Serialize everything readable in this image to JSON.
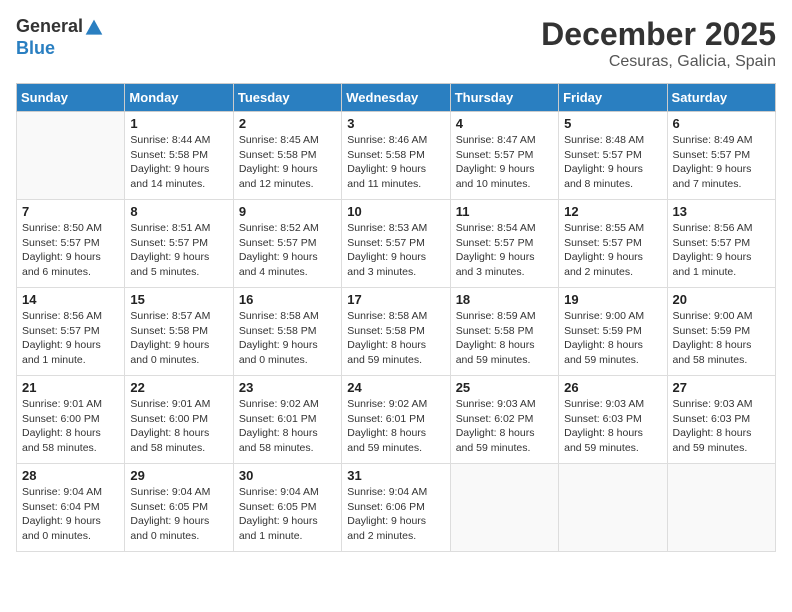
{
  "header": {
    "logo_general": "General",
    "logo_blue": "Blue",
    "month": "December 2025",
    "location": "Cesuras, Galicia, Spain"
  },
  "weekdays": [
    "Sunday",
    "Monday",
    "Tuesday",
    "Wednesday",
    "Thursday",
    "Friday",
    "Saturday"
  ],
  "weeks": [
    [
      {
        "day": "",
        "sunrise": "",
        "sunset": "",
        "daylight": ""
      },
      {
        "day": "1",
        "sunrise": "Sunrise: 8:44 AM",
        "sunset": "Sunset: 5:58 PM",
        "daylight": "Daylight: 9 hours and 14 minutes."
      },
      {
        "day": "2",
        "sunrise": "Sunrise: 8:45 AM",
        "sunset": "Sunset: 5:58 PM",
        "daylight": "Daylight: 9 hours and 12 minutes."
      },
      {
        "day": "3",
        "sunrise": "Sunrise: 8:46 AM",
        "sunset": "Sunset: 5:58 PM",
        "daylight": "Daylight: 9 hours and 11 minutes."
      },
      {
        "day": "4",
        "sunrise": "Sunrise: 8:47 AM",
        "sunset": "Sunset: 5:57 PM",
        "daylight": "Daylight: 9 hours and 10 minutes."
      },
      {
        "day": "5",
        "sunrise": "Sunrise: 8:48 AM",
        "sunset": "Sunset: 5:57 PM",
        "daylight": "Daylight: 9 hours and 8 minutes."
      },
      {
        "day": "6",
        "sunrise": "Sunrise: 8:49 AM",
        "sunset": "Sunset: 5:57 PM",
        "daylight": "Daylight: 9 hours and 7 minutes."
      }
    ],
    [
      {
        "day": "7",
        "sunrise": "Sunrise: 8:50 AM",
        "sunset": "Sunset: 5:57 PM",
        "daylight": "Daylight: 9 hours and 6 minutes."
      },
      {
        "day": "8",
        "sunrise": "Sunrise: 8:51 AM",
        "sunset": "Sunset: 5:57 PM",
        "daylight": "Daylight: 9 hours and 5 minutes."
      },
      {
        "day": "9",
        "sunrise": "Sunrise: 8:52 AM",
        "sunset": "Sunset: 5:57 PM",
        "daylight": "Daylight: 9 hours and 4 minutes."
      },
      {
        "day": "10",
        "sunrise": "Sunrise: 8:53 AM",
        "sunset": "Sunset: 5:57 PM",
        "daylight": "Daylight: 9 hours and 3 minutes."
      },
      {
        "day": "11",
        "sunrise": "Sunrise: 8:54 AM",
        "sunset": "Sunset: 5:57 PM",
        "daylight": "Daylight: 9 hours and 3 minutes."
      },
      {
        "day": "12",
        "sunrise": "Sunrise: 8:55 AM",
        "sunset": "Sunset: 5:57 PM",
        "daylight": "Daylight: 9 hours and 2 minutes."
      },
      {
        "day": "13",
        "sunrise": "Sunrise: 8:56 AM",
        "sunset": "Sunset: 5:57 PM",
        "daylight": "Daylight: 9 hours and 1 minute."
      }
    ],
    [
      {
        "day": "14",
        "sunrise": "Sunrise: 8:56 AM",
        "sunset": "Sunset: 5:57 PM",
        "daylight": "Daylight: 9 hours and 1 minute."
      },
      {
        "day": "15",
        "sunrise": "Sunrise: 8:57 AM",
        "sunset": "Sunset: 5:58 PM",
        "daylight": "Daylight: 9 hours and 0 minutes."
      },
      {
        "day": "16",
        "sunrise": "Sunrise: 8:58 AM",
        "sunset": "Sunset: 5:58 PM",
        "daylight": "Daylight: 9 hours and 0 minutes."
      },
      {
        "day": "17",
        "sunrise": "Sunrise: 8:58 AM",
        "sunset": "Sunset: 5:58 PM",
        "daylight": "Daylight: 8 hours and 59 minutes."
      },
      {
        "day": "18",
        "sunrise": "Sunrise: 8:59 AM",
        "sunset": "Sunset: 5:58 PM",
        "daylight": "Daylight: 8 hours and 59 minutes."
      },
      {
        "day": "19",
        "sunrise": "Sunrise: 9:00 AM",
        "sunset": "Sunset: 5:59 PM",
        "daylight": "Daylight: 8 hours and 59 minutes."
      },
      {
        "day": "20",
        "sunrise": "Sunrise: 9:00 AM",
        "sunset": "Sunset: 5:59 PM",
        "daylight": "Daylight: 8 hours and 58 minutes."
      }
    ],
    [
      {
        "day": "21",
        "sunrise": "Sunrise: 9:01 AM",
        "sunset": "Sunset: 6:00 PM",
        "daylight": "Daylight: 8 hours and 58 minutes."
      },
      {
        "day": "22",
        "sunrise": "Sunrise: 9:01 AM",
        "sunset": "Sunset: 6:00 PM",
        "daylight": "Daylight: 8 hours and 58 minutes."
      },
      {
        "day": "23",
        "sunrise": "Sunrise: 9:02 AM",
        "sunset": "Sunset: 6:01 PM",
        "daylight": "Daylight: 8 hours and 58 minutes."
      },
      {
        "day": "24",
        "sunrise": "Sunrise: 9:02 AM",
        "sunset": "Sunset: 6:01 PM",
        "daylight": "Daylight: 8 hours and 59 minutes."
      },
      {
        "day": "25",
        "sunrise": "Sunrise: 9:03 AM",
        "sunset": "Sunset: 6:02 PM",
        "daylight": "Daylight: 8 hours and 59 minutes."
      },
      {
        "day": "26",
        "sunrise": "Sunrise: 9:03 AM",
        "sunset": "Sunset: 6:03 PM",
        "daylight": "Daylight: 8 hours and 59 minutes."
      },
      {
        "day": "27",
        "sunrise": "Sunrise: 9:03 AM",
        "sunset": "Sunset: 6:03 PM",
        "daylight": "Daylight: 8 hours and 59 minutes."
      }
    ],
    [
      {
        "day": "28",
        "sunrise": "Sunrise: 9:04 AM",
        "sunset": "Sunset: 6:04 PM",
        "daylight": "Daylight: 9 hours and 0 minutes."
      },
      {
        "day": "29",
        "sunrise": "Sunrise: 9:04 AM",
        "sunset": "Sunset: 6:05 PM",
        "daylight": "Daylight: 9 hours and 0 minutes."
      },
      {
        "day": "30",
        "sunrise": "Sunrise: 9:04 AM",
        "sunset": "Sunset: 6:05 PM",
        "daylight": "Daylight: 9 hours and 1 minute."
      },
      {
        "day": "31",
        "sunrise": "Sunrise: 9:04 AM",
        "sunset": "Sunset: 6:06 PM",
        "daylight": "Daylight: 9 hours and 2 minutes."
      },
      {
        "day": "",
        "sunrise": "",
        "sunset": "",
        "daylight": ""
      },
      {
        "day": "",
        "sunrise": "",
        "sunset": "",
        "daylight": ""
      },
      {
        "day": "",
        "sunrise": "",
        "sunset": "",
        "daylight": ""
      }
    ]
  ]
}
